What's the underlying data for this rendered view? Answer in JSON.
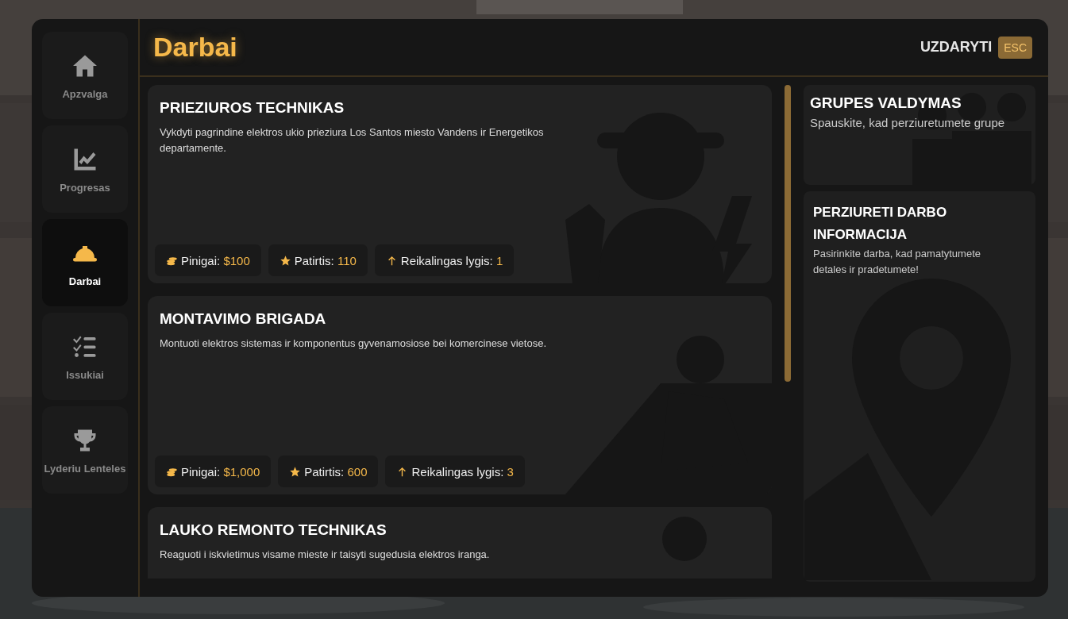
{
  "nav": [
    {
      "label": "Apzvalga",
      "selected": false
    },
    {
      "label": "Progresas",
      "selected": false
    },
    {
      "label": "Darbai",
      "selected": true
    },
    {
      "label": "Issukiai",
      "selected": false
    },
    {
      "label": "Lyderiu Lenteles",
      "selected": false
    }
  ],
  "header": {
    "title": "Darbai",
    "close_label": "UZDARYTI",
    "close_key": "ESC"
  },
  "jobs": [
    {
      "title": "PRIEZIUROS TECHNIKAS",
      "description": "Vykdyti pagrindine elektros ukio prieziura Los Santos miesto Vandens ir Energetikos departamente.",
      "stats": [
        {
          "kind": "money",
          "label": "Pinigai:",
          "value": "$100"
        },
        {
          "kind": "xp",
          "label": "Patirtis:",
          "value": "110"
        },
        {
          "kind": "level",
          "label": "Reikalingas lygis:",
          "value": "1"
        }
      ]
    },
    {
      "title": "MONTAVIMO BRIGADA",
      "description": "Montuoti elektros sistemas ir komponentus gyvenamosiose bei komercinese vietose.",
      "stats": [
        {
          "kind": "money",
          "label": "Pinigai:",
          "value": "$1,000"
        },
        {
          "kind": "xp",
          "label": "Patirtis:",
          "value": "600"
        },
        {
          "kind": "level",
          "label": "Reikalingas lygis:",
          "value": "3"
        }
      ]
    },
    {
      "title": "LAUKO REMONTO TECHNIKAS",
      "description": "Reaguoti i iskvietimus visame mieste ir taisyti sugedusia elektros iranga."
    }
  ],
  "side_cards": [
    {
      "title": "GRUPES VALDYMAS",
      "text": "Spauskite, kad perziuretumete grupe"
    },
    {
      "title": "PERZIURETI DARBO INFORMACIJA",
      "text": "Pasirinkite darba, kad pamatytumete detales ir pradetumete!"
    }
  ]
}
